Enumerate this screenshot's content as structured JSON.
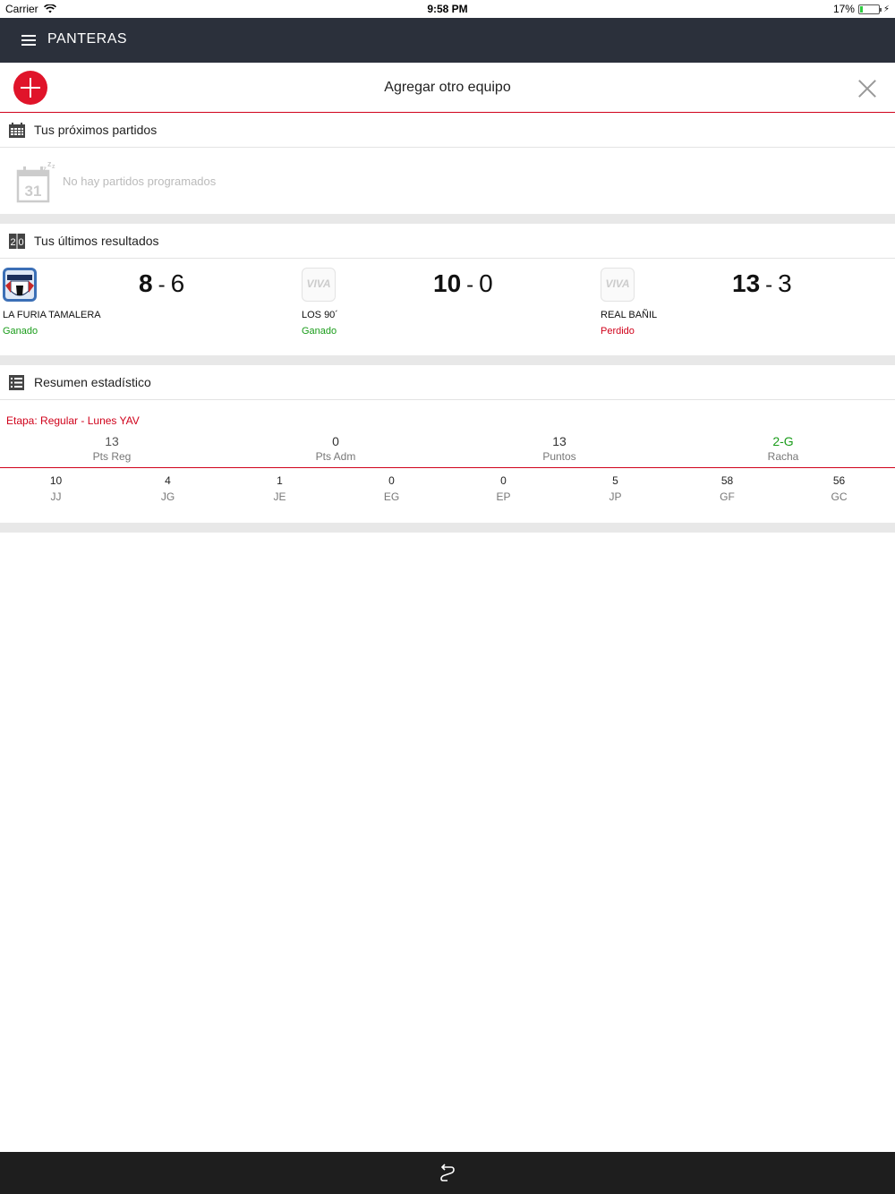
{
  "status_bar": {
    "carrier": "Carrier",
    "time": "9:58 PM",
    "battery": "17%",
    "battery_level": 0.17
  },
  "nav": {
    "title": "PANTERAS"
  },
  "add_team": {
    "label": "Agregar otro equipo"
  },
  "upcoming": {
    "title": "Tus próximos partidos",
    "empty_message": "No hay partidos programados",
    "calendar_day": "31"
  },
  "results": {
    "title": "Tus últimos resultados",
    "matches": [
      {
        "team": "LA FURIA TAMALERA",
        "score_a": "8",
        "score_b": "6",
        "outcome": "Ganado",
        "logo": "tamalera-logo"
      },
      {
        "team": "LOS 90´",
        "score_a": "10",
        "score_b": "0",
        "outcome": "Ganado",
        "logo": "VIVA"
      },
      {
        "team": "REAL BAÑIL",
        "score_a": "13",
        "score_b": "3",
        "outcome": "Perdido",
        "logo": "VIVA"
      }
    ]
  },
  "stats": {
    "title": "Resumen estadístico",
    "stage": "Etapa: Regular - Lunes YAV",
    "main": [
      {
        "value": "13",
        "label": "Pts Reg"
      },
      {
        "value": "0",
        "label": "Pts Adm"
      },
      {
        "value": "13",
        "label": "Puntos"
      },
      {
        "value": "2-G",
        "label": "Racha"
      }
    ],
    "sub": [
      {
        "value": "10",
        "label": "JJ"
      },
      {
        "value": "4",
        "label": "JG"
      },
      {
        "value": "1",
        "label": "JE"
      },
      {
        "value": "0",
        "label": "EG"
      },
      {
        "value": "0",
        "label": "EP"
      },
      {
        "value": "5",
        "label": "JP"
      },
      {
        "value": "58",
        "label": "GF"
      },
      {
        "value": "56",
        "label": "GC"
      }
    ]
  },
  "colors": {
    "accent": "#d0021b",
    "nav_bg": "#2b303b",
    "won": "#1a9c1a"
  }
}
